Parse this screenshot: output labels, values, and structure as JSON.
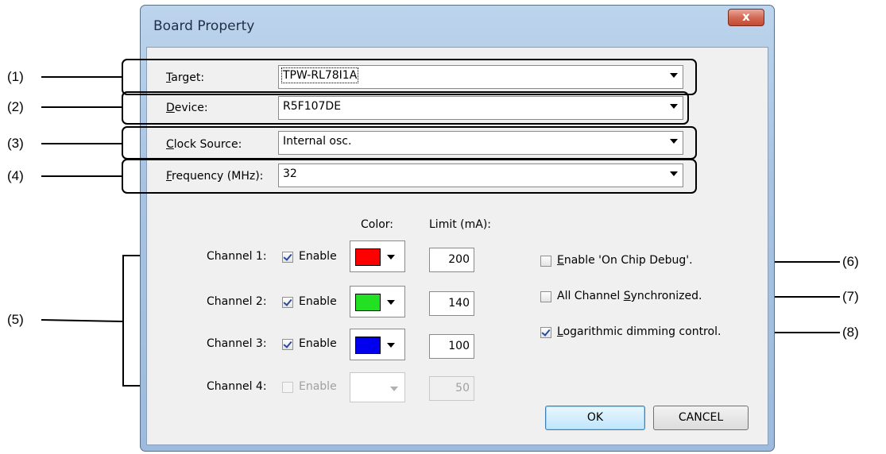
{
  "callouts": [
    "(1)",
    "(2)",
    "(3)",
    "(4)",
    "(5)",
    "(6)",
    "(7)",
    "(8)"
  ],
  "window": {
    "title": "Board Property",
    "close_label": "x"
  },
  "fields": {
    "target": {
      "label_key": "T",
      "label_rest": "arget:",
      "value": "TPW-RL78I1A"
    },
    "device": {
      "label_key": "D",
      "label_rest": "evice:",
      "value": "R5F107DE"
    },
    "clock": {
      "label_key": "C",
      "label_rest": "lock Source:",
      "value": "Internal osc."
    },
    "frequency": {
      "label_key": "F",
      "label_rest": "requency (MHz):",
      "value": "32"
    }
  },
  "headers": {
    "color": "Color:",
    "limit": "Limit (mA):"
  },
  "channels": [
    {
      "label": "Channel 1:",
      "enable": "Enable",
      "checked": true,
      "color": "#ff0000",
      "limit": "200",
      "enabled": true
    },
    {
      "label": "Channel 2:",
      "enable": "Enable",
      "checked": true,
      "color": "#22e022",
      "limit": "140",
      "enabled": true
    },
    {
      "label": "Channel 3:",
      "enable": "Enable",
      "checked": true,
      "color": "#0000ee",
      "limit": "100",
      "enabled": true
    },
    {
      "label": "Channel 4:",
      "enable": "Enable",
      "checked": false,
      "color": "",
      "limit": "50",
      "enabled": false
    }
  ],
  "options": {
    "debug": {
      "key": "E",
      "rest": "nable 'On Chip Debug'.",
      "checked": false
    },
    "sync": {
      "pre": "All Channel ",
      "key": "S",
      "rest": "ynchronized.",
      "checked": false
    },
    "log": {
      "key": "L",
      "rest": "ogarithmic dimming control.",
      "checked": true
    }
  },
  "buttons": {
    "ok": "OK",
    "cancel": "CANCEL"
  }
}
